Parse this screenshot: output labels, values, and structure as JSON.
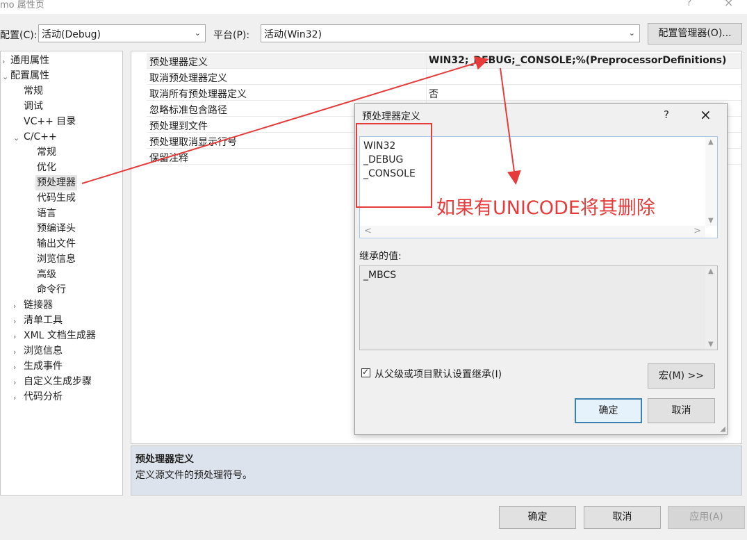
{
  "window": {
    "title": "mo 属性页",
    "help": "?",
    "close": "×"
  },
  "toolbar": {
    "config_label": "配置(C):",
    "config_value": "活动(Debug)",
    "platform_label": "平台(P):",
    "platform_value": "活动(Win32)",
    "config_manager": "配置管理器(O)..."
  },
  "tree": {
    "items": [
      {
        "label": "通用属性"
      },
      {
        "label": "配置属性"
      },
      {
        "label": "常规"
      },
      {
        "label": "调试"
      },
      {
        "label": "VC++ 目录"
      },
      {
        "label": "C/C++"
      },
      {
        "label": "常规"
      },
      {
        "label": "优化"
      },
      {
        "label": "预处理器"
      },
      {
        "label": "代码生成"
      },
      {
        "label": "语言"
      },
      {
        "label": "预编译头"
      },
      {
        "label": "输出文件"
      },
      {
        "label": "浏览信息"
      },
      {
        "label": "高级"
      },
      {
        "label": "命令行"
      },
      {
        "label": "链接器"
      },
      {
        "label": "清单工具"
      },
      {
        "label": "XML 文档生成器"
      },
      {
        "label": "浏览信息"
      },
      {
        "label": "生成事件"
      },
      {
        "label": "自定义生成步骤"
      },
      {
        "label": "代码分析"
      }
    ]
  },
  "grid": {
    "rows": [
      {
        "name": "预处理器定义",
        "value": "WIN32;_DEBUG;_CONSOLE;%(PreprocessorDefinitions)"
      },
      {
        "name": "取消预处理器定义",
        "value": ""
      },
      {
        "name": "取消所有预处理器定义",
        "value": "否"
      },
      {
        "name": "忽略标准包含路径",
        "value": ""
      },
      {
        "name": "预处理到文件",
        "value": ""
      },
      {
        "name": "预处理取消显示行号",
        "value": ""
      },
      {
        "name": "保留注释",
        "value": ""
      }
    ]
  },
  "description": {
    "heading": "预处理器定义",
    "text": "定义源文件的预处理符号。"
  },
  "dialog": {
    "title": "预处理器定义",
    "help": "?",
    "close": "×",
    "definitions": [
      "WIN32",
      "_DEBUG",
      "_CONSOLE"
    ],
    "inherited_label": "继承的值:",
    "inherited": [
      "_MBCS"
    ],
    "inherit_checkbox": "从父级或项目默认设置继承(I)",
    "inherit_checked": true,
    "macros_button": "宏(M) >>",
    "ok": "确定",
    "cancel": "取消"
  },
  "annotation": {
    "text": "如果有UNICODE将其删除",
    "color": "#e53b3b"
  },
  "footer": {
    "ok": "确定",
    "cancel": "取消",
    "apply": "应用(A)"
  }
}
